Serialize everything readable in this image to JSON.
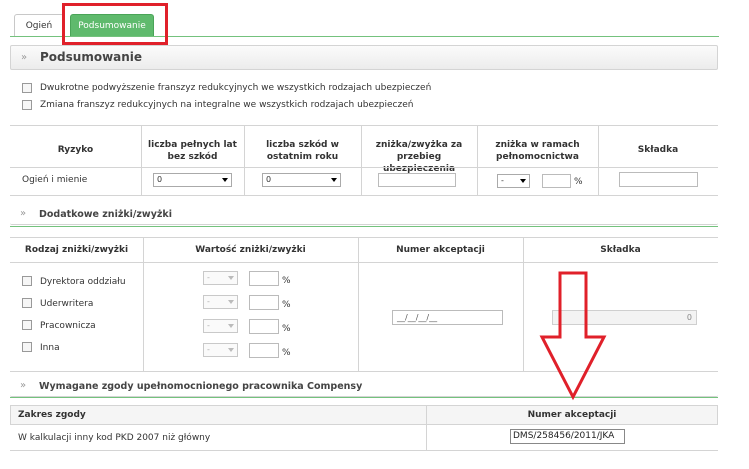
{
  "tabs": [
    {
      "label": "Ogień"
    },
    {
      "label": "Podsumowanie"
    }
  ],
  "summary": {
    "title": "Podsumowanie",
    "checkbox1": "Dwukrotne podwyższenie franszyz redukcyjnych we wszystkich rodzajach ubezpieczeń",
    "checkbox2": "Zmiana franszyz redukcyjnych na integralne we wszystkich rodzajach ubezpieczeń"
  },
  "risk_table": {
    "headers": [
      "Ryzyko",
      "liczba pełnych lat bez szkód",
      "liczba szkód w ostatnim roku",
      "zniżka/zwyżka za przebieg ubezpieczenia",
      "zniżka w ramach pełnomocnictwa",
      "Składka"
    ],
    "row": {
      "risk": "Ogień i mienie",
      "years_value": "0",
      "claims_value": "0",
      "proxy_select": "-",
      "percent": "%"
    }
  },
  "extra": {
    "title": "Dodatkowe zniżki/zwyżki",
    "headers": [
      "Rodzaj zniżki/zwyżki",
      "Wartość zniżki/zwyżki",
      "Numer akceptacji",
      "Składka"
    ],
    "rows": [
      {
        "label": "Dyrektora oddziału",
        "select": "-",
        "percent": "%"
      },
      {
        "label": "Uderwritera",
        "select": "-",
        "percent": "%"
      },
      {
        "label": "Pracownicza",
        "select": "-",
        "percent": "%"
      },
      {
        "label": "Inna",
        "select": "-",
        "percent": "%"
      }
    ],
    "acceptance_mask": "__/__/__/__",
    "premium_value": "0"
  },
  "consent": {
    "title": "Wymagane zgody upełnomocnionego pracownika Compensy",
    "headers": [
      "Zakres zgody",
      "Numer akceptacji"
    ],
    "row": {
      "scope": "W kalkulacji inny kod PKD 2007 niż główny",
      "acceptance": "DMS/258456/2011/JKA"
    }
  },
  "colors": {
    "tab_active": "#5fba6d",
    "highlight": "#e0202a",
    "separator": "#74c27d"
  },
  "icons": {
    "section": "double-chevron-icon",
    "callout": "red-down-arrow-icon"
  }
}
